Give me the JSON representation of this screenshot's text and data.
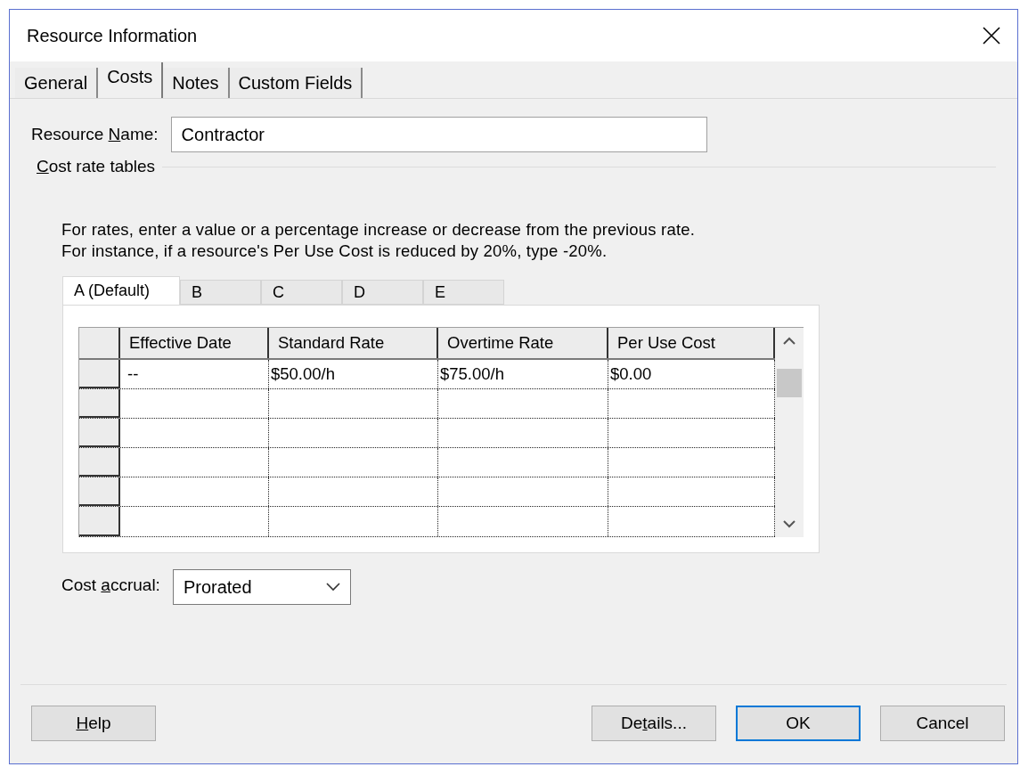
{
  "window": {
    "title": "Resource Information"
  },
  "tabs": [
    {
      "label": "General",
      "selected": false
    },
    {
      "label": "Costs",
      "selected": true
    },
    {
      "label": "Notes",
      "selected": false
    },
    {
      "label": "Custom Fields",
      "selected": false
    }
  ],
  "resource_name": {
    "label_parts": [
      {
        "text": "Resource ",
        "underlined": false
      },
      {
        "text": "N",
        "underlined": true
      },
      {
        "text": "ame:",
        "underlined": false
      }
    ],
    "value": "Contractor"
  },
  "cost_rate_tables": {
    "label_parts": [
      {
        "text": "C",
        "underlined": true
      },
      {
        "text": "ost rate tables",
        "underlined": false
      }
    ],
    "instructions": "For rates, enter a value or a percentage increase or decrease from the previous rate. For instance, if a resource's Per Use Cost is reduced by 20%, type -20%.",
    "tabs": [
      {
        "label": "A (Default)",
        "selected": true
      },
      {
        "label": "B",
        "selected": false
      },
      {
        "label": "C",
        "selected": false
      },
      {
        "label": "D",
        "selected": false
      },
      {
        "label": "E",
        "selected": false
      }
    ],
    "table": {
      "columns": [
        "Effective Date",
        "Standard Rate",
        "Overtime Rate",
        "Per Use Cost"
      ],
      "rows": [
        [
          "--",
          "$50.00/h",
          "$75.00/h",
          "$0.00"
        ]
      ]
    }
  },
  "cost_accrual": {
    "label_parts": [
      {
        "text": "Cost ",
        "underlined": false
      },
      {
        "text": "a",
        "underlined": true
      },
      {
        "text": "ccrual:",
        "underlined": false
      }
    ],
    "value": "Prorated"
  },
  "buttons": [
    {
      "kind": "left",
      "label_parts": [
        {
          "text": "H",
          "underlined": true
        },
        {
          "text": "elp",
          "underlined": false
        }
      ],
      "default": false
    },
    {
      "kind": "right",
      "label_parts": [
        {
          "text": "De",
          "underlined": false
        },
        {
          "text": "t",
          "underlined": true
        },
        {
          "text": "ails...",
          "underlined": false
        }
      ],
      "default": false
    },
    {
      "kind": "right",
      "label_parts": [
        {
          "text": "OK",
          "underlined": false
        }
      ],
      "default": true
    },
    {
      "kind": "right",
      "label_parts": [
        {
          "text": "Cancel",
          "underlined": false
        }
      ],
      "default": false
    }
  ]
}
